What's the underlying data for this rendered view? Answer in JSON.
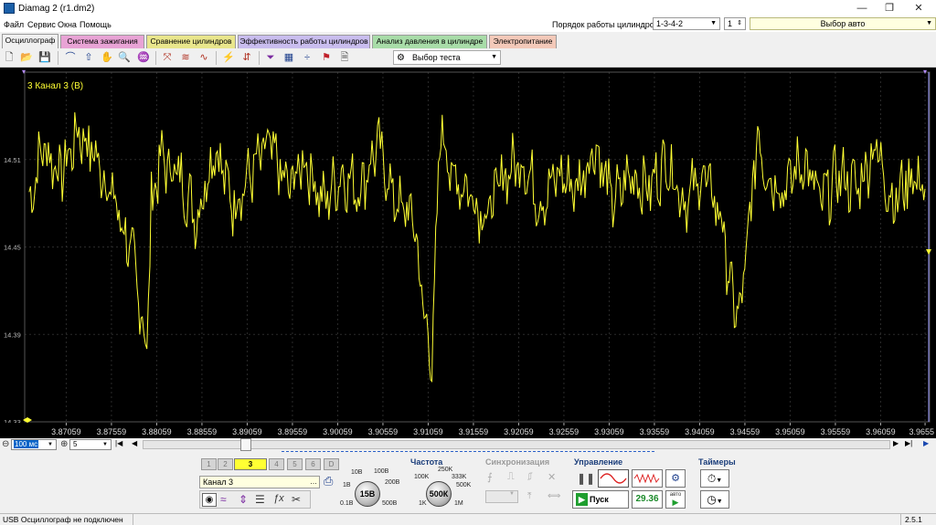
{
  "window": {
    "title": "Diamag 2 (r1.dm2)",
    "minimize": "—",
    "restore": "❐",
    "close": "✕"
  },
  "menu": [
    "Файл",
    "Сервис",
    "Окна",
    "Помощь"
  ],
  "header": {
    "cyl_order_label": "Порядок работы цилиндров",
    "cyl_order_value": "1-3-4-2",
    "cyl_num": "1",
    "auto_select": "Выбор авто"
  },
  "tabs": [
    {
      "label": "Осциллограф",
      "color": "#f0f0f0",
      "active": true
    },
    {
      "label": "Система зажигания",
      "color": "#e8a3d5"
    },
    {
      "label": "Сравнение цилиндров",
      "color": "#e9e68c"
    },
    {
      "label": "Эффективность работы цилиндров",
      "color": "#c9bdee"
    },
    {
      "label": "Анализ давления в цилиндре",
      "color": "#a8dca8"
    },
    {
      "label": "Электропитание",
      "color": "#f3c9b9"
    }
  ],
  "toolbar": {
    "test_select": "Выбор теста"
  },
  "scope": {
    "channel_label": "3 Канал 3 (В)",
    "trace_color": "#ffff33",
    "y_ticks": [
      "14.51",
      "14.45",
      "14.39",
      "14.33"
    ],
    "x_ticks": [
      "3.87059",
      "3.87559",
      "3.88059",
      "3.88559",
      "3.89059",
      "3.89559",
      "3.90059",
      "3.90559",
      "3.91059",
      "3.91559",
      "3.92059",
      "3.92559",
      "3.93059",
      "3.93559",
      "3.94059",
      "3.94559",
      "3.95059",
      "3.95559",
      "3.96059",
      "3.9655"
    ]
  },
  "chart_data": {
    "type": "line",
    "title": "3 Канал 3 (В)",
    "xlabel": "",
    "ylabel": "",
    "xlim": [
      3.866,
      3.966
    ],
    "ylim": [
      14.33,
      14.57
    ],
    "grid": true,
    "x_ticks": [
      3.87059,
      3.87559,
      3.88059,
      3.88559,
      3.89059,
      3.89559,
      3.90059,
      3.90559,
      3.91059,
      3.91559,
      3.92059,
      3.92559,
      3.93059,
      3.93559,
      3.94059,
      3.94559,
      3.95059,
      3.95559,
      3.96059,
      3.9655
    ],
    "y_ticks": [
      14.51,
      14.45,
      14.39,
      14.33
    ],
    "series": [
      {
        "x": [
          3.8665,
          3.868,
          3.87,
          3.872,
          3.874,
          3.876,
          3.877,
          3.878,
          3.879,
          3.8795,
          3.88,
          3.881,
          3.883,
          3.885,
          3.887,
          3.889,
          3.891,
          3.893,
          3.895,
          3.897,
          3.899,
          3.901,
          3.903,
          3.905,
          3.907,
          3.909,
          3.91,
          3.911,
          3.912,
          3.913,
          3.915,
          3.917,
          3.919,
          3.921,
          3.923,
          3.925,
          3.927,
          3.929,
          3.931,
          3.933,
          3.935,
          3.937,
          3.939,
          3.941,
          3.943,
          3.944,
          3.945,
          3.946,
          3.947,
          3.948,
          3.95,
          3.952,
          3.954,
          3.956,
          3.958,
          3.96,
          3.962,
          3.964,
          3.9655
        ],
        "y": [
          14.48,
          14.52,
          14.5,
          14.53,
          14.51,
          14.48,
          14.46,
          14.44,
          14.4,
          14.38,
          14.48,
          14.51,
          14.5,
          14.47,
          14.52,
          14.48,
          14.5,
          14.52,
          14.49,
          14.51,
          14.48,
          14.5,
          14.49,
          14.52,
          14.48,
          14.47,
          14.41,
          14.37,
          14.54,
          14.5,
          14.49,
          14.47,
          14.5,
          14.51,
          14.48,
          14.5,
          14.49,
          14.52,
          14.48,
          14.5,
          14.49,
          14.51,
          14.48,
          14.5,
          14.47,
          14.42,
          14.4,
          14.46,
          14.53,
          14.5,
          14.49,
          14.51,
          14.48,
          14.5,
          14.49,
          14.52,
          14.48,
          14.5,
          14.49
        ],
        "color": "#ffff33"
      }
    ]
  },
  "scroll": {
    "timebase": "100 мс",
    "count": "5"
  },
  "channels": [
    "1",
    "2",
    "3",
    "4",
    "5",
    "6",
    "D"
  ],
  "channel_name": "Канал 3",
  "voltage": {
    "value": "15В",
    "marks": [
      "10В",
      "100В",
      "1В",
      "200В",
      "0.1В",
      "500В"
    ]
  },
  "frequency": {
    "title": "Частота",
    "value": "500К",
    "marks": [
      "100K",
      "250K",
      "333K",
      "500K",
      "1K",
      "1M"
    ]
  },
  "sync": {
    "title": "Синхронизация"
  },
  "control": {
    "title": "Управление",
    "start": "Пуск",
    "fps": "29.36",
    "auto": "авто"
  },
  "timers": {
    "title": "Таймеры"
  },
  "status": {
    "left": "USB Осциллограф не подключен",
    "version": "2.5.1"
  }
}
